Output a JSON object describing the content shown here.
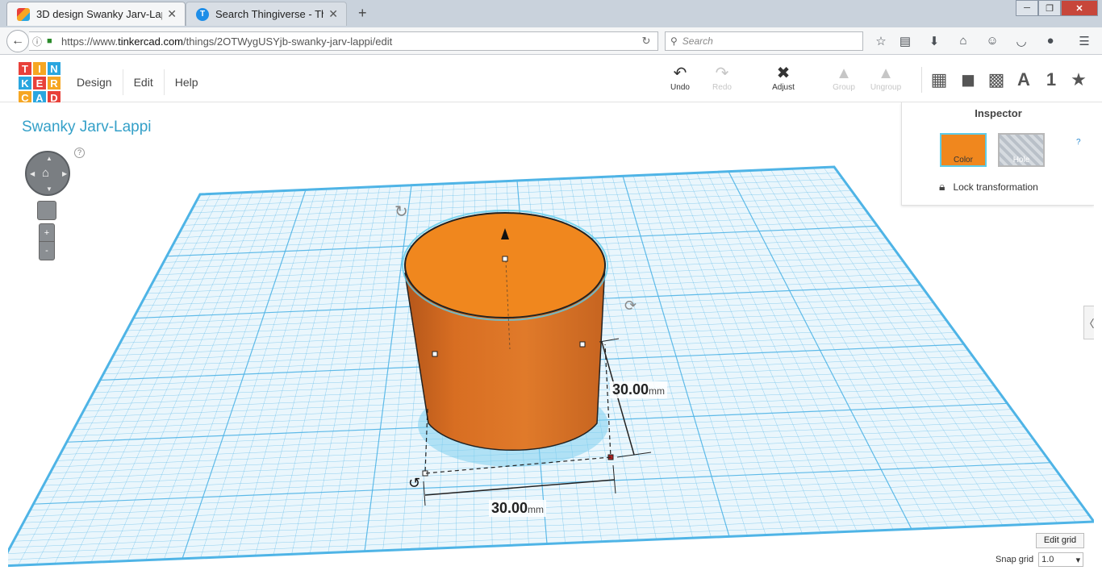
{
  "browser": {
    "tabs": [
      {
        "title": "3D design Swanky Jarv-Lap...",
        "active": true,
        "favicon": "tinkercad-icon"
      },
      {
        "title": "Search Thingiverse - Thing...",
        "active": false,
        "favicon": "thingiverse-icon"
      }
    ],
    "url_prefix": "https://www.",
    "url_host": "tinkercad.com",
    "url_path": "/things/2OTWygUSYjb-swanky-jarv-lappi/edit",
    "search_placeholder": "Search"
  },
  "app": {
    "logo_letters": [
      "T",
      "I",
      "N",
      "K",
      "E",
      "R",
      "C",
      "A",
      "D"
    ],
    "logo_colors": [
      "#e8413a",
      "#f6a623",
      "#2aa6df",
      "#2aa6df",
      "#e8413a",
      "#f6a623",
      "#f6a623",
      "#2aa6df",
      "#e8413a"
    ],
    "menu": [
      "Design",
      "Edit",
      "Help"
    ],
    "tools": {
      "undo": "Undo",
      "redo": "Redo",
      "adjust": "Adjust",
      "group": "Group",
      "ungroup": "Ungroup"
    },
    "view_icons": [
      "grid-view-icon",
      "box-view-icon",
      "wire-box-icon",
      "text-icon",
      "number-icon",
      "star-icon"
    ],
    "view_text": {
      "text": "A",
      "number": "1"
    }
  },
  "workspace": {
    "design_title": "Swanky Jarv-Lappi",
    "help": "?",
    "inspector": {
      "title": "Inspector",
      "color_label": "Color",
      "hole_label": "Hole",
      "help": "?",
      "lock_label": "Lock transformation"
    },
    "dimensions": {
      "height_value": "30.00",
      "width_value": "30.00",
      "unit": "mm"
    },
    "edit_grid_label": "Edit grid",
    "snap_grid_label": "Snap grid",
    "snap_grid_value": "1.0",
    "accent_color": "#f0871e",
    "grid_color": "#4fb4e6"
  }
}
